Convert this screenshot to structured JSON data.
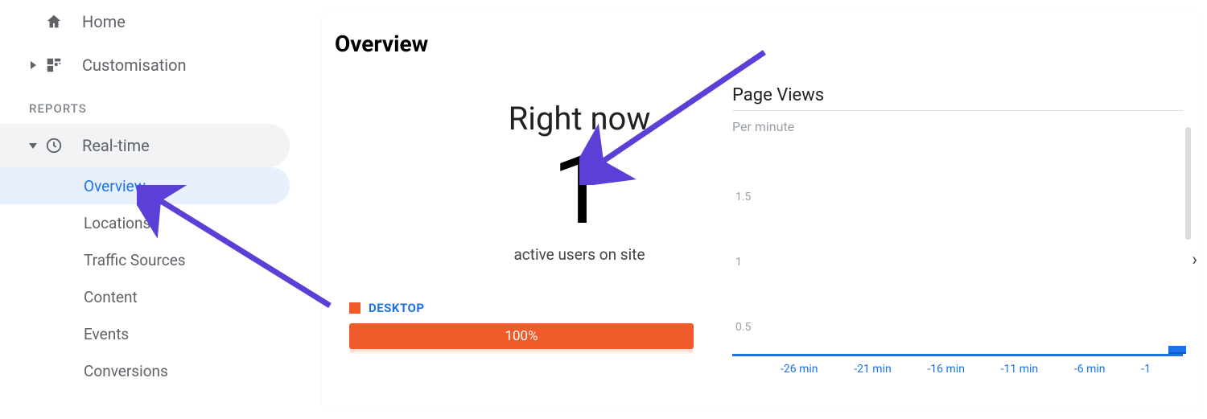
{
  "sidebar": {
    "home": "Home",
    "customisation": "Customisation",
    "reports_header": "REPORTS",
    "realtime": "Real-time",
    "subitems": [
      {
        "label": "Overview",
        "active": true
      },
      {
        "label": "Locations",
        "active": false
      },
      {
        "label": "Traffic Sources",
        "active": false
      },
      {
        "label": "Content",
        "active": false
      },
      {
        "label": "Events",
        "active": false
      },
      {
        "label": "Conversions",
        "active": false
      }
    ]
  },
  "main": {
    "title": "Overview",
    "right_now_heading": "Right now",
    "active_users_value": "1",
    "active_users_caption": "active users on site",
    "legend": {
      "label": "DESKTOP",
      "color": "#f15a29"
    },
    "percent_bar": {
      "label": "100%",
      "value_pct": 100,
      "color": "#f15a29"
    }
  },
  "chart_data": {
    "type": "bar",
    "title": "Page Views",
    "subtitle": "Per minute",
    "xlabel": "",
    "ylabel": "",
    "ylim": [
      0,
      2
    ],
    "y_ticks": [
      0.5,
      1.0,
      1.5
    ],
    "categories": [
      "-26 min",
      "-21 min",
      "-16 min",
      "-11 min",
      "-6 min",
      "-1"
    ],
    "values": [
      0,
      0,
      0,
      0,
      0,
      0.2
    ]
  }
}
